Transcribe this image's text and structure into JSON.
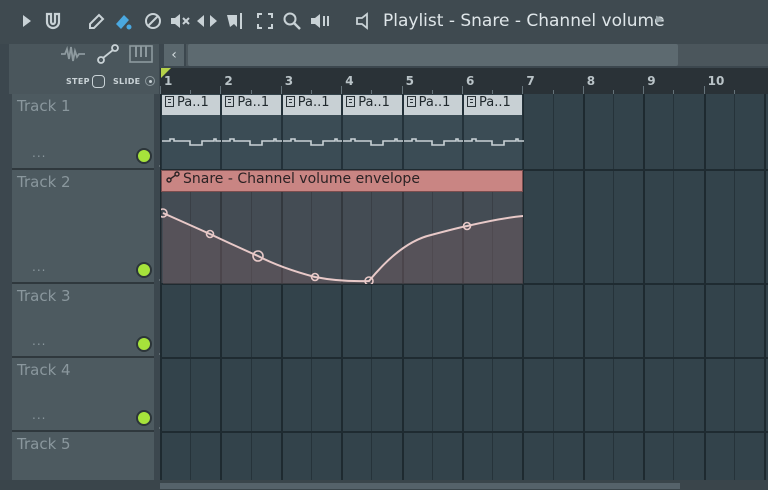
{
  "toolbar": {
    "icons": [
      "play-icon",
      "magnet-icon",
      "pencil-icon",
      "paint-icon",
      "delete-icon",
      "mute-icon",
      "slip-icon",
      "slice-icon",
      "select-icon",
      "zoom-icon",
      "playback-icon"
    ],
    "title": "Playlist - Snare - Channel volume"
  },
  "left_panel": {
    "step_label": "STEP",
    "slide_label": "SLIDE"
  },
  "ruler": {
    "bars": [
      "1",
      "2",
      "3",
      "4",
      "5",
      "6",
      "7",
      "8",
      "9",
      "10"
    ]
  },
  "tracks": [
    {
      "name": "Track 1",
      "dots": "..."
    },
    {
      "name": "Track 2",
      "dots": "..."
    },
    {
      "name": "Track 3",
      "dots": "..."
    },
    {
      "name": "Track 4",
      "dots": "..."
    },
    {
      "name": "Track 5",
      "dots": ""
    }
  ],
  "pattern_clips": {
    "labels": [
      "Pa..1",
      "Pa..1",
      "Pa..1",
      "Pa..1",
      "Pa..1",
      "Pa..1"
    ]
  },
  "automation_clip": {
    "label": "Snare - Channel volume envelope",
    "color": "#c98583"
  },
  "colors": {
    "led": "#a6e33b",
    "envelope_line": "#e8c9c8",
    "background": "#33434b"
  }
}
